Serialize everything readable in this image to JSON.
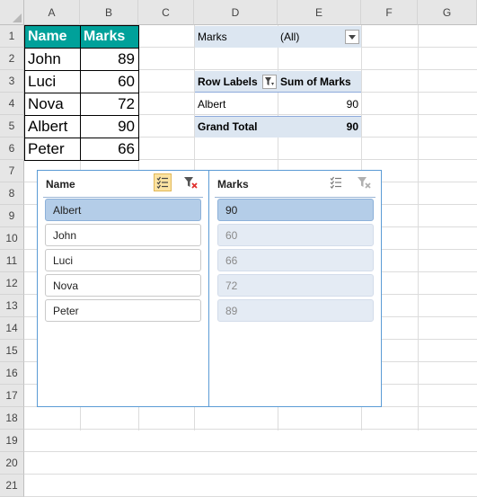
{
  "columns": [
    "A",
    "B",
    "C",
    "D",
    "E",
    "F",
    "G"
  ],
  "rows": [
    "1",
    "2",
    "3",
    "4",
    "5",
    "6",
    "7",
    "8",
    "9",
    "10",
    "11",
    "12",
    "13",
    "14",
    "15",
    "16",
    "17",
    "18",
    "19",
    "20",
    "21"
  ],
  "table": {
    "headers": [
      "Name",
      "Marks"
    ],
    "rows": [
      [
        "John",
        "89"
      ],
      [
        "Luci",
        "60"
      ],
      [
        "Nova",
        "72"
      ],
      [
        "Albert",
        "90"
      ],
      [
        "Peter",
        "66"
      ]
    ]
  },
  "pivot": {
    "filter_label": "Marks",
    "filter_value": "(All)",
    "row_labels_header": "Row Labels",
    "sum_header": "Sum of Marks",
    "row_name": "Albert",
    "row_value": "90",
    "grand_total_label": "Grand Total",
    "grand_total_value": "90"
  },
  "slicer_name": {
    "title": "Name",
    "items": [
      "Albert",
      "John",
      "Luci",
      "Nova",
      "Peter"
    ],
    "selected": "Albert"
  },
  "slicer_marks": {
    "title": "Marks",
    "items": [
      "90",
      "60",
      "66",
      "72",
      "89"
    ],
    "selected": "90"
  },
  "colors": {
    "table_header": "#00a19a",
    "pivot_fill": "#dce6f1",
    "slicer_border": "#5b9bd5",
    "slicer_selected": "#b4cde8"
  }
}
